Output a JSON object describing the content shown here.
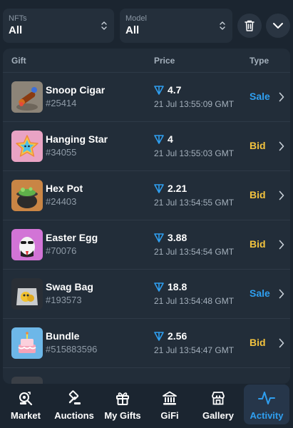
{
  "filters": {
    "nfts": {
      "label": "NFTs",
      "value": "All"
    },
    "model": {
      "label": "Model",
      "value": "All"
    }
  },
  "table": {
    "headers": {
      "gift": "Gift",
      "price": "Price",
      "type": "Type"
    },
    "rows": [
      {
        "name": "Snoop Cigar",
        "number": "#25414",
        "price": "4.7",
        "date": "21 Jul 13:55:09 GMT",
        "type": "Sale"
      },
      {
        "name": "Hanging Star",
        "number": "#34055",
        "price": "4",
        "date": "21 Jul 13:55:03 GMT",
        "type": "Bid"
      },
      {
        "name": "Hex Pot",
        "number": "#24403",
        "price": "2.21",
        "date": "21 Jul 13:54:55 GMT",
        "type": "Bid"
      },
      {
        "name": "Easter Egg",
        "number": "#70076",
        "price": "3.88",
        "date": "21 Jul 13:54:54 GMT",
        "type": "Bid"
      },
      {
        "name": "Swag Bag",
        "number": "#193573",
        "price": "18.8",
        "date": "21 Jul 13:54:48 GMT",
        "type": "Sale"
      },
      {
        "name": "Bundle",
        "number": "#515883596",
        "price": "2.56",
        "date": "21 Jul 13:54:47 GMT",
        "type": "Bid"
      }
    ]
  },
  "nav": {
    "items": [
      {
        "label": "Market",
        "icon": "market-icon"
      },
      {
        "label": "Auctions",
        "icon": "gavel-icon"
      },
      {
        "label": "My Gifts",
        "icon": "gift-icon"
      },
      {
        "label": "GiFi",
        "icon": "bank-icon"
      },
      {
        "label": "Gallery",
        "icon": "store-icon"
      },
      {
        "label": "Activity",
        "icon": "activity-icon",
        "active": true
      }
    ]
  },
  "colors": {
    "background": "#1b2530",
    "panel": "#222d39",
    "sale": "#2f9ff0",
    "bid": "#f3c33e",
    "ton": "#2f9ff0"
  }
}
